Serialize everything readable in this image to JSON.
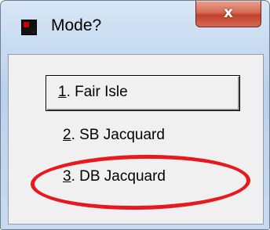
{
  "dialog": {
    "title": "Mode?",
    "close_glyph": "x"
  },
  "options": [
    {
      "mnemonic": "1",
      "rest": ". Fair Isle"
    },
    {
      "mnemonic": "2",
      "rest": ". SB Jacquard"
    },
    {
      "mnemonic": "3",
      "rest": ". DB Jacquard"
    }
  ],
  "highlight": {
    "color": "#e8191e",
    "target_option_index": 2
  }
}
